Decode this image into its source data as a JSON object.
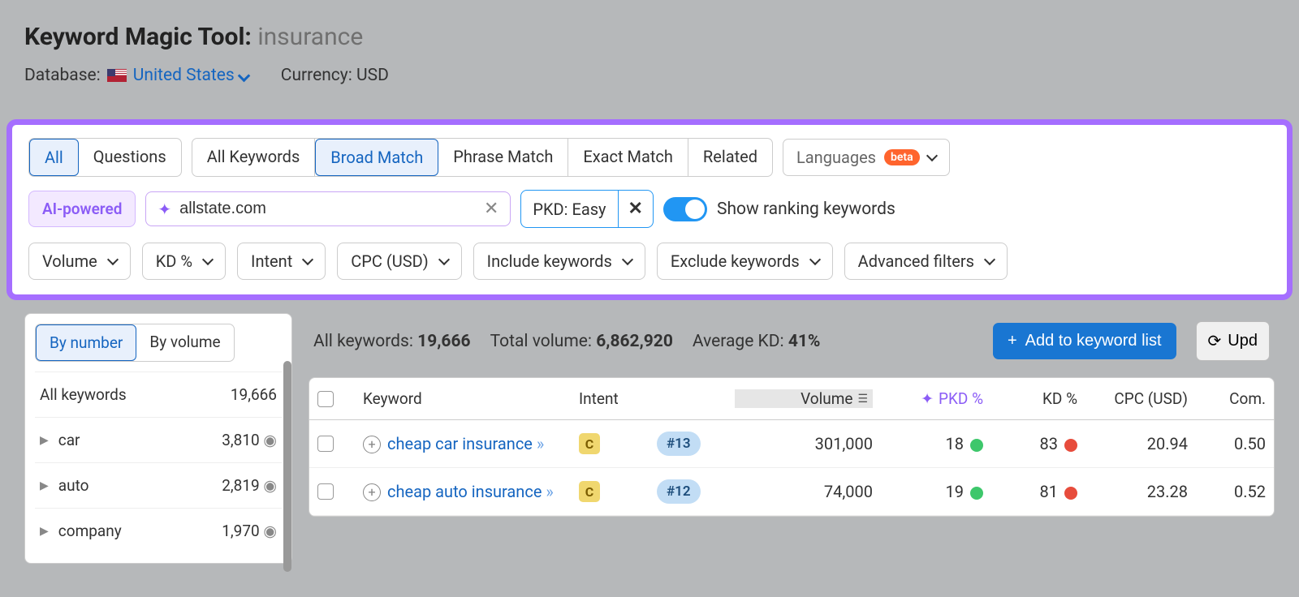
{
  "header": {
    "title_prefix": "Keyword Magic Tool:",
    "title_query": "insurance",
    "database_label": "Database:",
    "database_value": "United States",
    "currency_label": "Currency: USD"
  },
  "tabs1": {
    "all": "All",
    "questions": "Questions"
  },
  "tabs2": {
    "all_kw": "All Keywords",
    "broad": "Broad Match",
    "phrase": "Phrase Match",
    "exact": "Exact Match",
    "related": "Related"
  },
  "languages": {
    "label": "Languages",
    "beta": "beta"
  },
  "ai_powered": "AI-powered",
  "domain_input": "allstate.com",
  "pkd_filter": "PKD: Easy",
  "toggle_label": "Show ranking keywords",
  "filters": {
    "volume": "Volume",
    "kd": "KD %",
    "intent": "Intent",
    "cpc": "CPC (USD)",
    "include": "Include keywords",
    "exclude": "Exclude keywords",
    "advanced": "Advanced filters"
  },
  "sidebar": {
    "by_number": "By number",
    "by_volume": "By volume",
    "all_kw_label": "All keywords",
    "all_kw_count": "19,666",
    "groups": [
      {
        "name": "car",
        "count": "3,810"
      },
      {
        "name": "auto",
        "count": "2,819"
      },
      {
        "name": "company",
        "count": "1,970"
      }
    ]
  },
  "stats": {
    "all_kw_label": "All keywords:",
    "all_kw_value": "19,666",
    "total_vol_label": "Total volume:",
    "total_vol_value": "6,862,920",
    "avg_kd_label": "Average KD:",
    "avg_kd_value": "41%",
    "add_btn": "Add to keyword list",
    "upd_btn": "Upd"
  },
  "columns": {
    "keyword": "Keyword",
    "intent": "Intent",
    "volume": "Volume",
    "pkd": "PKD %",
    "kd": "KD %",
    "cpc": "CPC (USD)",
    "com": "Com."
  },
  "rows": [
    {
      "keyword": "cheap car insurance",
      "rank": "#13",
      "intent": "C",
      "volume": "301,000",
      "pkd": "18",
      "pkd_color": "green",
      "kd": "83",
      "kd_color": "red",
      "cpc": "20.94",
      "com": "0.50"
    },
    {
      "keyword": "cheap auto insurance",
      "rank": "#12",
      "intent": "C",
      "volume": "74,000",
      "pkd": "19",
      "pkd_color": "green",
      "kd": "81",
      "kd_color": "red",
      "cpc": "23.28",
      "com": "0.52"
    }
  ]
}
